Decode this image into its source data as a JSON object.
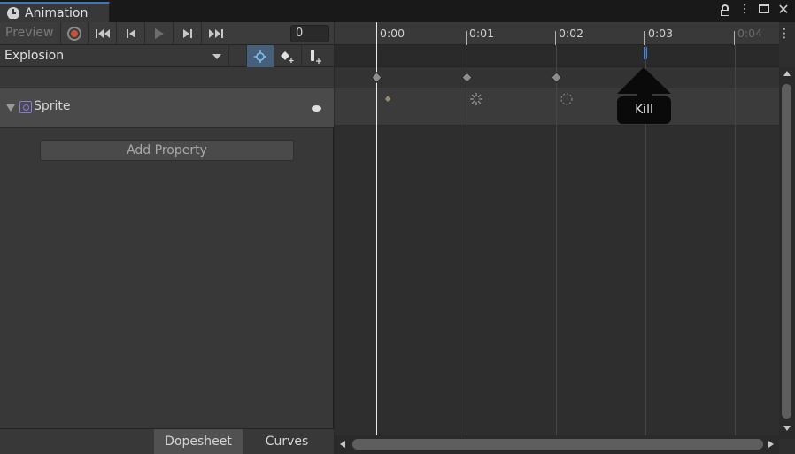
{
  "window": {
    "tab_title": "Animation",
    "tab_icon": "clock-icon",
    "controls": [
      "lock-icon",
      "kebab-menu-icon",
      "maximize-icon",
      "close-icon"
    ]
  },
  "toolbar": {
    "preview_label": "Preview",
    "frame_value": "0",
    "buttons": [
      "record-icon",
      "first-frame-icon",
      "prev-frame-icon",
      "play-icon",
      "next-frame-icon",
      "last-frame-icon"
    ]
  },
  "clip": {
    "selected": "Explosion",
    "mode_buttons": [
      "snap-keyframe-icon",
      "add-keyframe-icon",
      "add-event-icon"
    ]
  },
  "properties": [
    {
      "label": "Sprite",
      "icon": "sprite-renderer-icon",
      "expanded": false
    }
  ],
  "add_property_label": "Add Property",
  "bottom_tabs": [
    {
      "label": "Dopesheet",
      "active": true
    },
    {
      "label": "Curves",
      "active": false
    }
  ],
  "timeline": {
    "ticks": [
      {
        "label": "0:00",
        "dim": false
      },
      {
        "label": "0:01",
        "dim": false
      },
      {
        "label": "0:02",
        "dim": false
      },
      {
        "label": "0:03",
        "dim": false
      },
      {
        "label": "0:04",
        "dim": true
      }
    ],
    "event_tooltip": "Kill",
    "playhead_time": "0:00"
  },
  "colors": {
    "accent_tab": "#3a79bb",
    "event_marker": "#4a84d4",
    "record": "#c4543c",
    "active_mode": "#46607c"
  }
}
